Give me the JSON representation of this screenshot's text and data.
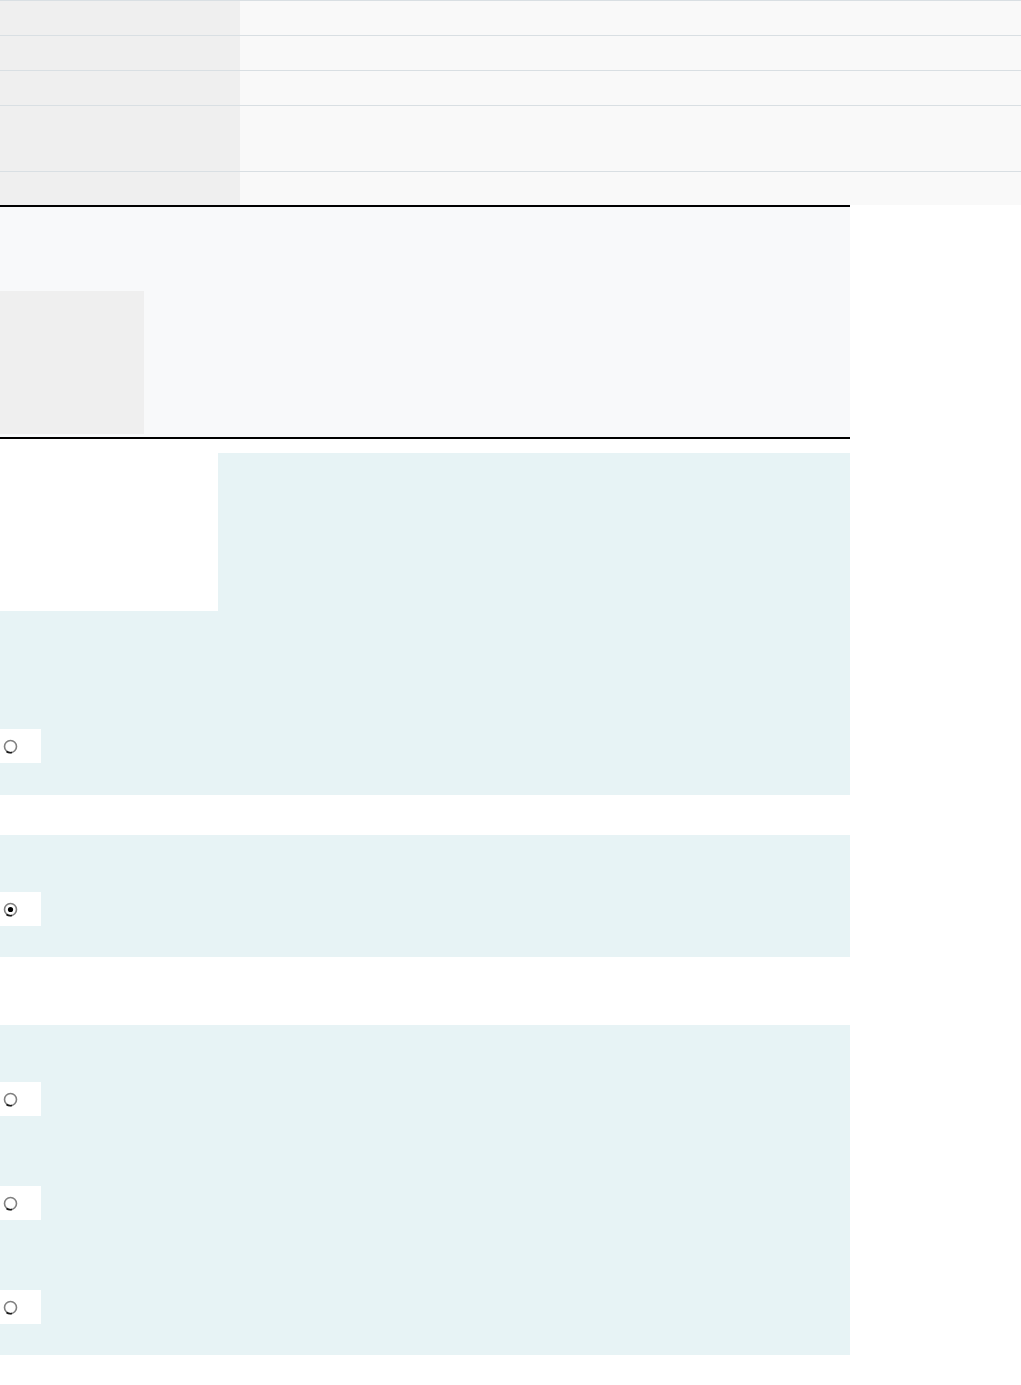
{
  "questions": [
    {
      "kind": "info",
      "options": [
        {
          "selected": false
        }
      ]
    },
    {
      "kind": "plain",
      "options": [
        {
          "selected": true
        }
      ]
    },
    {
      "kind": "plain",
      "options": [
        {
          "selected": false
        },
        {
          "selected": false
        },
        {
          "selected": false
        }
      ]
    }
  ]
}
